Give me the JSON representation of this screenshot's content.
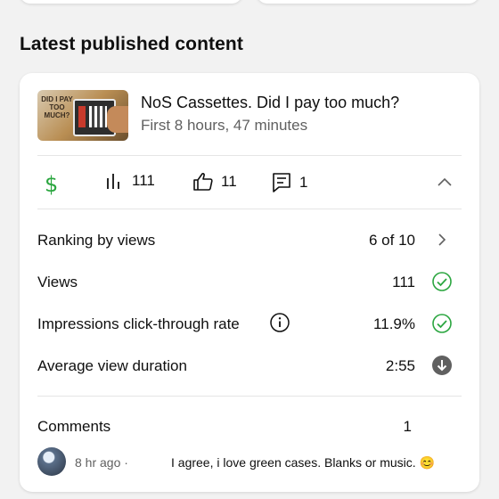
{
  "section": {
    "title": "Latest published content"
  },
  "video": {
    "thumbnail_text": "DID I PAY TOO MUCH?",
    "title": "NoS Cassettes. Did I pay too much?",
    "subtitle": "First 8 hours, 47 minutes"
  },
  "stats": {
    "revenue_icon": "dollar-icon",
    "views": "111",
    "likes": "11",
    "comments": "1"
  },
  "metrics": [
    {
      "label": "Ranking by views",
      "value": "6 of 10",
      "status": "chevron-right"
    },
    {
      "label": "Views",
      "value": "111",
      "status": "check-circle"
    },
    {
      "label": "Impressions click-through rate",
      "value": "11.9%",
      "status": "check-circle"
    },
    {
      "label": "Average view duration",
      "value": "2:55",
      "status": "down-arrow-circle"
    }
  ],
  "comments_summary": {
    "label": "Comments",
    "count": "1"
  },
  "latest_comment": {
    "time": "8 hr ago ·",
    "text": "I agree, i love green cases. Blanks or music. 😊"
  },
  "colors": {
    "green": "#2ba640",
    "grey_icon": "#606060",
    "dark_icon": "#606060"
  }
}
